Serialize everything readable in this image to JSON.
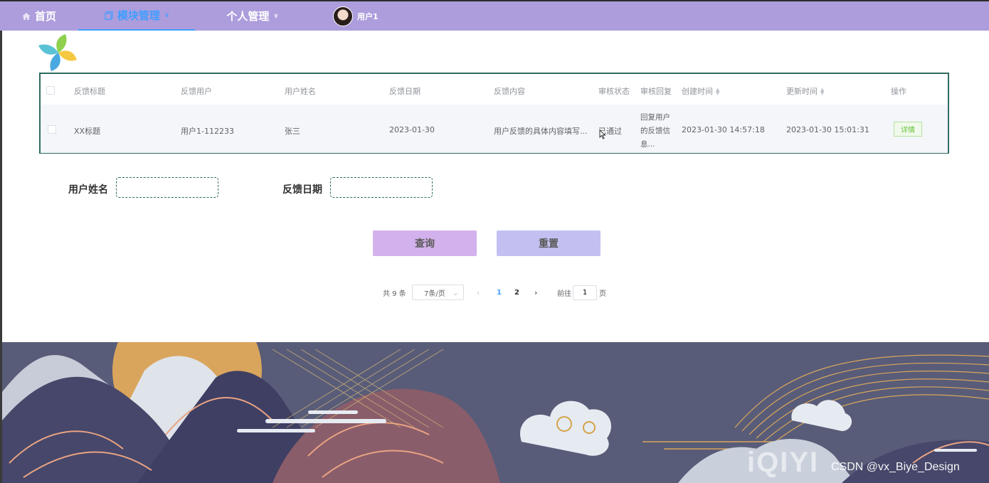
{
  "nav": {
    "home": "首页",
    "modules": "模块管理",
    "personal": "个人管理",
    "username": "用户1",
    "active_color": "#409eff",
    "bar_color": "#ad9ddc"
  },
  "table": {
    "headers": {
      "title": "反馈标题",
      "user": "反馈用户",
      "name": "用户姓名",
      "date": "反馈日期",
      "content": "反馈内容",
      "status": "审核状态",
      "reply": "审核回复",
      "created": "创建时间",
      "updated": "更新时间",
      "actions": "操作"
    },
    "rows": [
      {
        "title": "XX标题",
        "user": "用户1-112233",
        "name": "张三",
        "date": "2023-01-30",
        "content": "用户反馈的具体内容填写...",
        "status": "已通过",
        "reply_line1": "回复用户",
        "reply_line2": "的反馈信",
        "reply_line3": "息...",
        "created": "2023-01-30 14:57:18",
        "updated": "2023-01-30 15:01:31",
        "action": "详情"
      }
    ]
  },
  "form": {
    "name_label": "用户姓名",
    "name_value": "",
    "date_label": "反馈日期",
    "date_value": "",
    "search_label": "查询",
    "reset_label": "重置"
  },
  "pagination": {
    "total": "共 9 条",
    "page_size": "7条/页",
    "pages": [
      "1",
      "2"
    ],
    "current_page": "1",
    "goto_label": "前往",
    "goto_value": "1",
    "page_suffix": "页"
  },
  "watermark": {
    "brand": "iQIYI",
    "text": "CSDN @vx_Biye_Design"
  }
}
